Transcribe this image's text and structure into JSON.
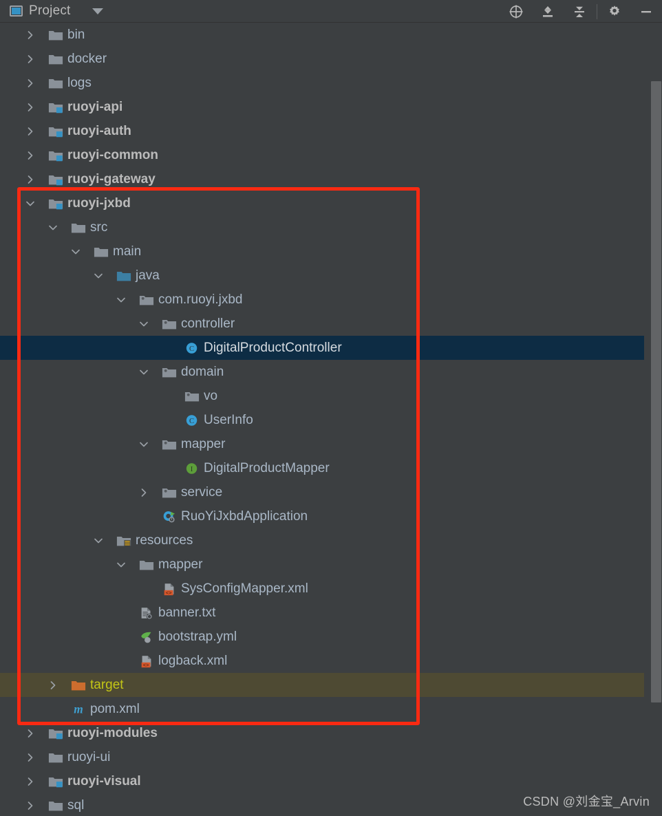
{
  "header": {
    "tab_label": "Project",
    "project_icon": "project-window-icon",
    "dropdown_icon": "chevron-down-icon",
    "actions": [
      {
        "name": "select-opened-file-icon",
        "title": "Select Opened File"
      },
      {
        "name": "expand-all-icon",
        "title": "Expand All"
      },
      {
        "name": "collapse-all-icon",
        "title": "Collapse All"
      },
      {
        "name": "settings-gear-icon",
        "title": "Settings"
      },
      {
        "name": "hide-icon",
        "title": "Hide"
      }
    ]
  },
  "colors": {
    "background": "#3c3f41",
    "selection": "#0d2c44",
    "excluded_row": "#4e4a33",
    "excluded_text": "#c3c516",
    "annotation": "#f92a12",
    "text": "#a9b7c6",
    "module_badge": "#3592c4",
    "class_icon": "#389fd6",
    "interface_icon": "#5d9e3a",
    "xml_badge": "#d4562b",
    "maven_m": "#3f9fd0",
    "target_folder": "#cc6d2e"
  },
  "tree": {
    "rows": [
      {
        "label": "bin",
        "indent": 0,
        "chevron": "collapsed",
        "icon": "folder-icon",
        "style": "plain"
      },
      {
        "label": "docker",
        "indent": 0,
        "chevron": "collapsed",
        "icon": "folder-icon",
        "style": "plain"
      },
      {
        "label": "logs",
        "indent": 0,
        "chevron": "collapsed",
        "icon": "folder-icon",
        "style": "plain"
      },
      {
        "label": "ruoyi-api",
        "indent": 0,
        "chevron": "collapsed",
        "icon": "module-folder-icon",
        "style": "module"
      },
      {
        "label": "ruoyi-auth",
        "indent": 0,
        "chevron": "collapsed",
        "icon": "module-folder-icon",
        "style": "module"
      },
      {
        "label": "ruoyi-common",
        "indent": 0,
        "chevron": "collapsed",
        "icon": "module-folder-icon",
        "style": "module"
      },
      {
        "label": "ruoyi-gateway",
        "indent": 0,
        "chevron": "collapsed",
        "icon": "module-folder-icon",
        "style": "module"
      },
      {
        "label": "ruoyi-jxbd",
        "indent": 0,
        "chevron": "expanded",
        "icon": "module-folder-icon",
        "style": "module"
      },
      {
        "label": "src",
        "indent": 1,
        "chevron": "expanded",
        "icon": "folder-icon",
        "style": "plain"
      },
      {
        "label": "main",
        "indent": 2,
        "chevron": "expanded",
        "icon": "folder-icon",
        "style": "plain"
      },
      {
        "label": "java",
        "indent": 3,
        "chevron": "expanded",
        "icon": "source-root-icon",
        "style": "plain"
      },
      {
        "label": "com.ruoyi.jxbd",
        "indent": 4,
        "chevron": "expanded",
        "icon": "package-icon",
        "style": "plain"
      },
      {
        "label": "controller",
        "indent": 5,
        "chevron": "expanded",
        "icon": "package-icon",
        "style": "plain"
      },
      {
        "label": "DigitalProductController",
        "indent": 6,
        "chevron": "none",
        "icon": "java-class-icon",
        "style": "sel",
        "selected": true
      },
      {
        "label": "domain",
        "indent": 5,
        "chevron": "expanded",
        "icon": "package-icon",
        "style": "plain"
      },
      {
        "label": "vo",
        "indent": 6,
        "chevron": "none",
        "icon": "package-icon",
        "style": "plain"
      },
      {
        "label": "UserInfo",
        "indent": 6,
        "chevron": "none",
        "icon": "java-class-icon",
        "style": "plain"
      },
      {
        "label": "mapper",
        "indent": 5,
        "chevron": "expanded",
        "icon": "package-icon",
        "style": "plain"
      },
      {
        "label": "DigitalProductMapper",
        "indent": 6,
        "chevron": "none",
        "icon": "java-interface-icon",
        "style": "plain"
      },
      {
        "label": "service",
        "indent": 5,
        "chevron": "collapsed",
        "icon": "package-icon",
        "style": "plain"
      },
      {
        "label": "RuoYiJxbdApplication",
        "indent": 5,
        "chevron": "none",
        "icon": "spring-boot-app-icon",
        "style": "plain"
      },
      {
        "label": "resources",
        "indent": 3,
        "chevron": "expanded",
        "icon": "resources-root-icon",
        "style": "plain"
      },
      {
        "label": "mapper",
        "indent": 4,
        "chevron": "expanded",
        "icon": "folder-icon",
        "style": "plain"
      },
      {
        "label": "SysConfigMapper.xml",
        "indent": 5,
        "chevron": "none",
        "icon": "xml-file-icon",
        "style": "plain"
      },
      {
        "label": "banner.txt",
        "indent": 4,
        "chevron": "none",
        "icon": "text-file-icon",
        "style": "plain"
      },
      {
        "label": "bootstrap.yml",
        "indent": 4,
        "chevron": "none",
        "icon": "spring-yaml-icon",
        "style": "plain"
      },
      {
        "label": "logback.xml",
        "indent": 4,
        "chevron": "none",
        "icon": "xml-file-icon",
        "style": "plain"
      },
      {
        "label": "target",
        "indent": 1,
        "chevron": "collapsed",
        "icon": "excluded-folder-icon",
        "style": "excluded",
        "excluded": true
      },
      {
        "label": "pom.xml",
        "indent": 1,
        "chevron": "none",
        "icon": "maven-pom-icon",
        "style": "plain"
      },
      {
        "label": "ruoyi-modules",
        "indent": 0,
        "chevron": "collapsed",
        "icon": "module-folder-icon",
        "style": "module"
      },
      {
        "label": "ruoyi-ui",
        "indent": 0,
        "chevron": "collapsed",
        "icon": "folder-icon",
        "style": "plain"
      },
      {
        "label": "ruoyi-visual",
        "indent": 0,
        "chevron": "collapsed",
        "icon": "module-folder-icon",
        "style": "module"
      },
      {
        "label": "sql",
        "indent": 0,
        "chevron": "collapsed",
        "icon": "folder-icon",
        "style": "plain"
      }
    ]
  },
  "annotation": {
    "shape": "rectangle",
    "color": "#f92a12",
    "covers_from": "ruoyi-jxbd",
    "covers_to": "pom.xml"
  },
  "scrollbar": {
    "orientation": "vertical",
    "name": "tree-scrollbar"
  },
  "watermark": {
    "text": "CSDN @刘金宝_Arvin"
  }
}
